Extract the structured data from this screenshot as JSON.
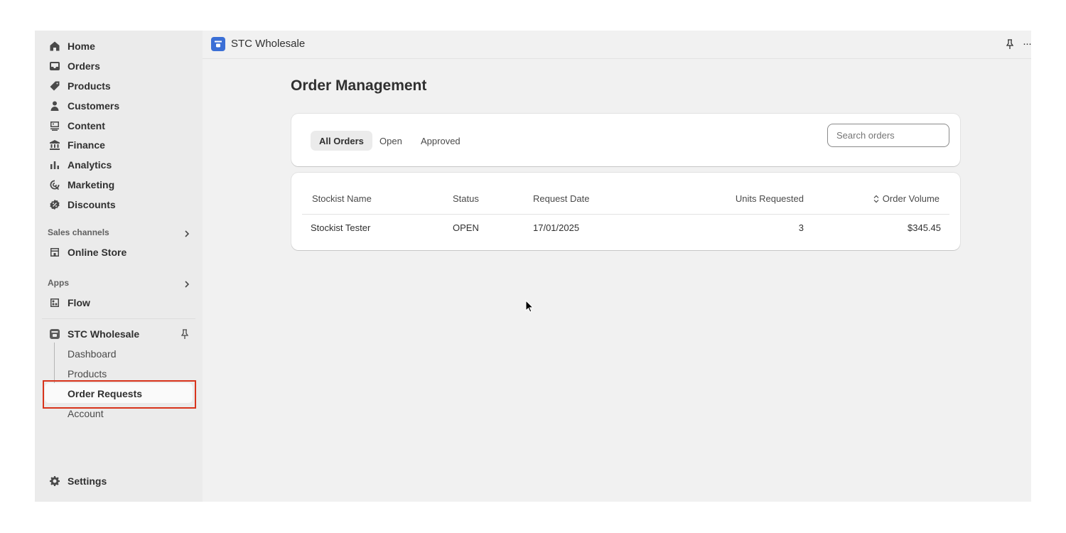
{
  "sidebar": {
    "nav": [
      {
        "label": "Home",
        "icon": "home-icon"
      },
      {
        "label": "Orders",
        "icon": "inbox-icon"
      },
      {
        "label": "Products",
        "icon": "tag-icon"
      },
      {
        "label": "Customers",
        "icon": "person-icon"
      },
      {
        "label": "Content",
        "icon": "content-icon"
      },
      {
        "label": "Finance",
        "icon": "bank-icon"
      },
      {
        "label": "Analytics",
        "icon": "bar-chart-icon"
      },
      {
        "label": "Marketing",
        "icon": "target-icon"
      },
      {
        "label": "Discounts",
        "icon": "discount-icon"
      }
    ],
    "sales_channels_label": "Sales channels",
    "online_store": "Online Store",
    "apps_label": "Apps",
    "flow": "Flow",
    "app_name": "STC Wholesale",
    "app_sub_items": [
      "Dashboard",
      "Products",
      "Order Requests",
      "Account"
    ],
    "active_sub_item": "Order Requests",
    "settings": "Settings"
  },
  "topbar": {
    "title": "STC Wholesale",
    "more": "···"
  },
  "main": {
    "page_title": "Order Management",
    "tabs": [
      {
        "label": "All Orders",
        "active": true
      },
      {
        "label": "Open",
        "active": false
      },
      {
        "label": "Approved",
        "active": false
      }
    ],
    "search_placeholder": "Search orders",
    "table": {
      "headers": [
        "Stockist Name",
        "Status",
        "Request Date",
        "Units Requested",
        "Order Volume"
      ],
      "rows": [
        [
          "Stockist Tester",
          "OPEN",
          "17/01/2025",
          "3",
          "$345.45"
        ]
      ]
    }
  },
  "colors": {
    "highlight": "#d8341c",
    "app_logo": "#3b6fd6"
  }
}
